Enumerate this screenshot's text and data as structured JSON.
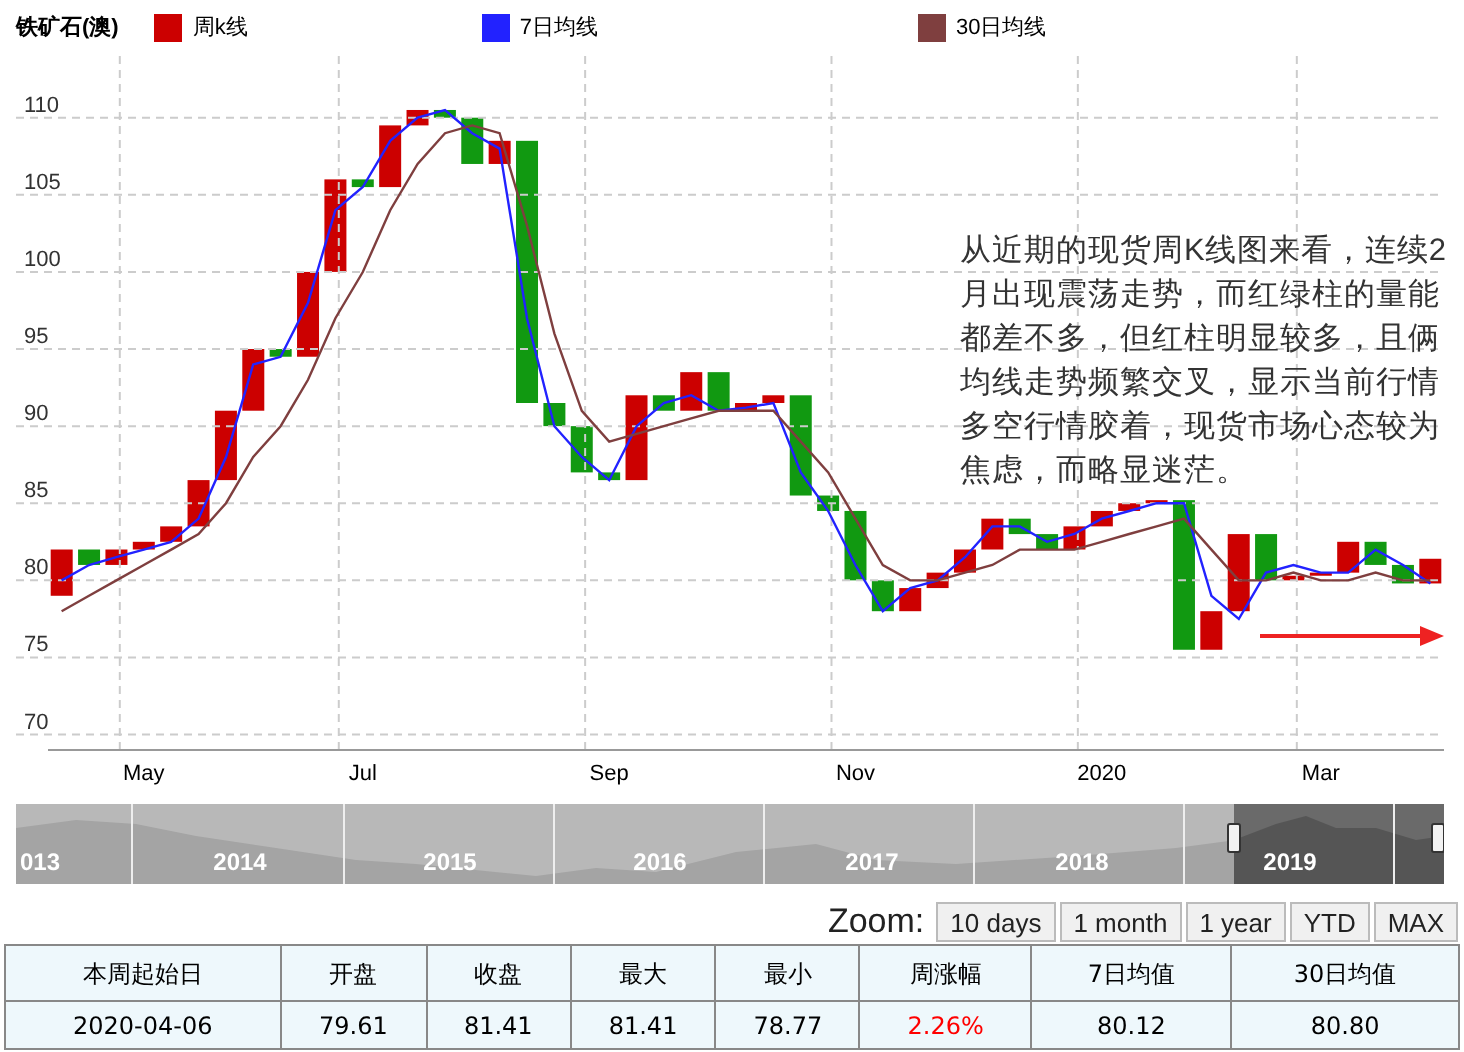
{
  "legend": {
    "title": "铁矿石(澳)",
    "candle": {
      "label": "周k线",
      "color": "#cc0000"
    }
  },
  "chart": {
    "chart_data": {
      "type": "line",
      "grid": true,
      "categories": [
        null,
        null,
        null,
        "May",
        null,
        null,
        null,
        null,
        null,
        null,
        null,
        "Jul",
        null,
        null,
        null,
        null,
        null,
        null,
        null,
        null,
        "Sep",
        null,
        null,
        null,
        null,
        null,
        null,
        null,
        null,
        "Nov",
        null,
        null,
        null,
        null,
        null,
        null,
        null,
        null,
        "2020",
        null,
        null,
        null,
        null,
        null,
        null,
        null,
        "Mar",
        null,
        null,
        null,
        null
      ],
      "ylim": [
        69,
        114
      ],
      "yticks": [
        70,
        75,
        80,
        85,
        90,
        95,
        100,
        105,
        110
      ],
      "series": [
        {
          "name": "7日均线",
          "color": "#2222ff",
          "values": [
            80,
            81,
            81.5,
            82,
            82.5,
            84,
            88,
            94,
            94.5,
            98,
            104,
            105.5,
            108.5,
            110,
            110.5,
            109,
            108,
            97,
            90,
            88,
            86.5,
            90,
            91.5,
            92,
            91,
            91.2,
            91.5,
            87,
            84.5,
            81,
            78,
            79.5,
            80,
            81.5,
            83.5,
            83.5,
            82.5,
            83,
            84,
            84.5,
            85,
            85,
            79,
            77.5,
            80.5,
            81,
            80.5,
            80.5,
            82,
            81,
            79.8
          ]
        },
        {
          "name": "30日均线",
          "color": "#7f3f3f",
          "values": [
            78,
            79,
            80,
            81,
            82,
            83,
            85,
            88,
            90,
            93,
            97,
            100,
            104,
            107,
            109,
            109.5,
            109,
            103,
            96,
            91,
            89,
            89.5,
            90,
            90.5,
            91,
            91,
            91,
            89,
            87,
            84,
            81,
            80,
            80,
            80.5,
            81,
            82,
            82,
            82,
            82.5,
            83,
            83.5,
            84,
            82,
            80,
            80,
            80.5,
            80,
            80,
            80.5,
            80,
            80
          ]
        }
      ]
    }
  },
  "annotation": "从近期的现货周K线图来看，连续2月出现震荡走势，而红绿柱的量能都差不多，但红柱明显较多，且俩均线走势频繁交叉，显示当前行情多空行情胶着，现货市场心态较为焦虑，而略显迷茫。",
  "navigator": {
    "labels": [
      "013",
      "2014",
      "2015",
      "2016",
      "2017",
      "2018",
      "2019"
    ]
  },
  "zoom": {
    "label": "Zoom:",
    "buttons": [
      "10 days",
      "1 month",
      "1 year",
      "YTD",
      "MAX"
    ]
  },
  "table": {
    "columns": [
      "本周起始日",
      "开盘",
      "收盘",
      "最大",
      "最小",
      "周涨幅",
      "7日均值",
      "30日均值"
    ],
    "rows": [
      [
        {
          "text": "2020-04-06"
        },
        {
          "text": "79.61"
        },
        {
          "text": "81.41"
        },
        {
          "text": "81.41"
        },
        {
          "text": "78.77"
        },
        {
          "text": "2.26%",
          "color": "#ff0000"
        },
        {
          "text": "80.12"
        },
        {
          "text": "80.80"
        }
      ]
    ]
  }
}
